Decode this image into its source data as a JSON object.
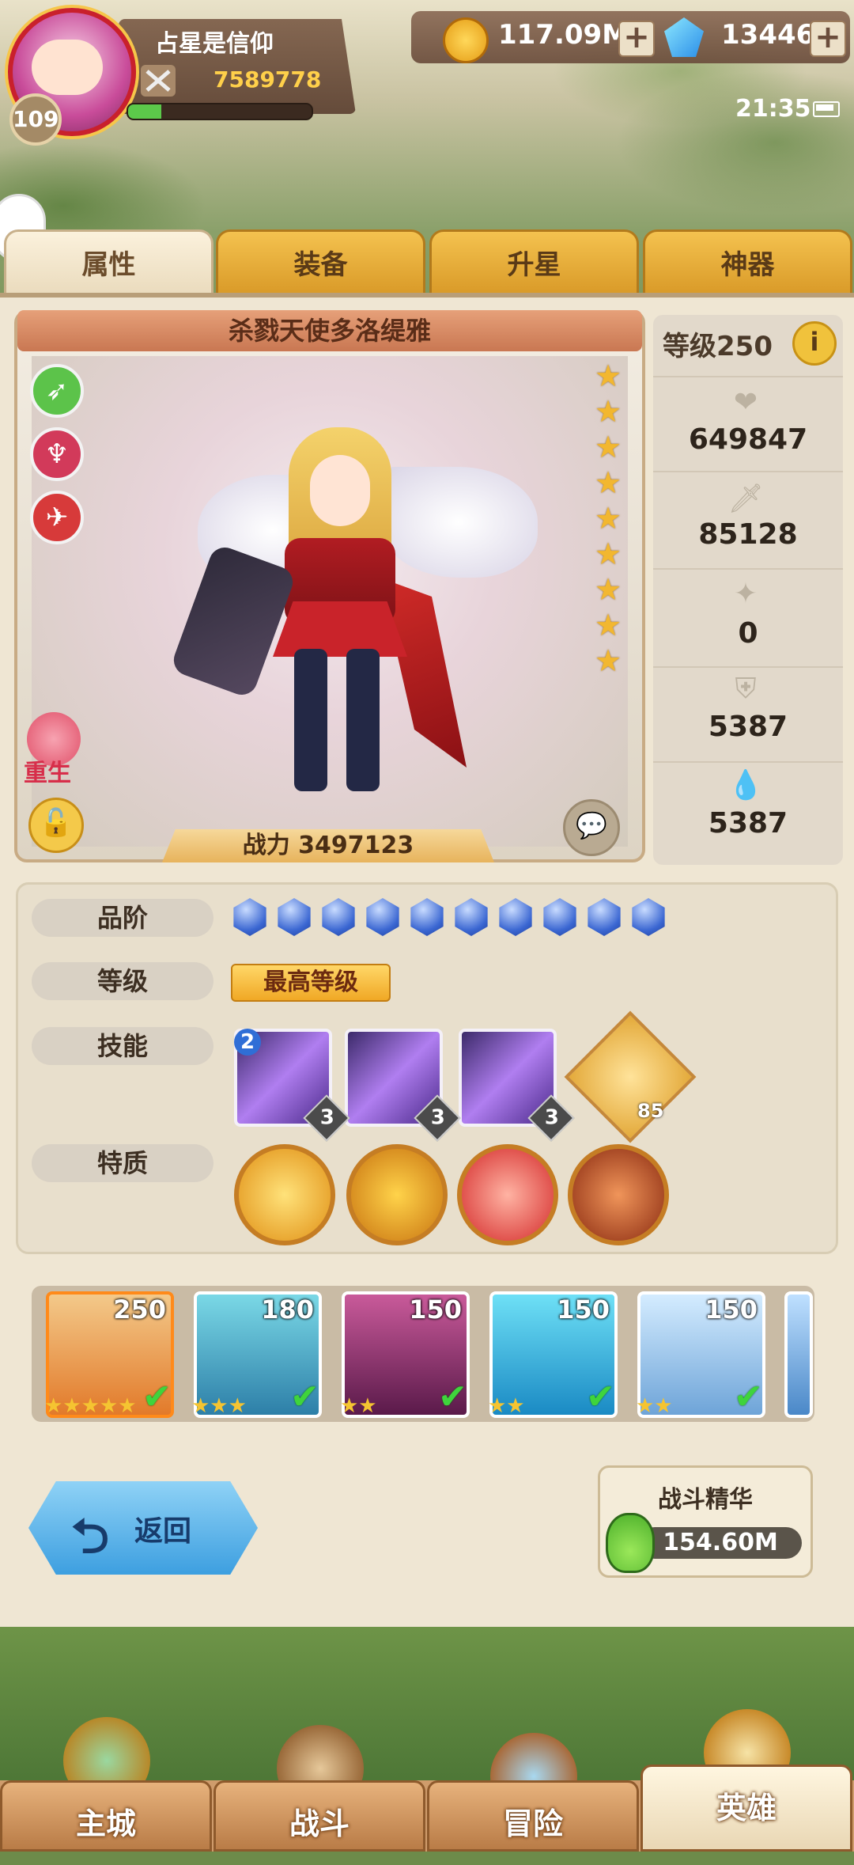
{
  "player": {
    "name": "占星是信仰",
    "level": "109",
    "power": "7589778"
  },
  "currency": {
    "gold": "117.09M",
    "gems": "13446",
    "add_label": "+"
  },
  "status": {
    "time": "21:35"
  },
  "tabs": [
    "属性",
    "装备",
    "升星",
    "神器"
  ],
  "hero": {
    "name": "杀戮天使多洛缇雅",
    "battle_power": "战力 3497123",
    "level_label": "等级250",
    "info_label": "i",
    "stars": 9,
    "rebirth_label": "重生",
    "stats": [
      "649847",
      "85128",
      "0",
      "5387",
      "5387"
    ],
    "stat_icons": [
      "heart-icon",
      "sword-icon",
      "star-icon",
      "shield-icon",
      "drop-icon"
    ]
  },
  "details": {
    "grade_label": "品阶",
    "grade_count": 10,
    "level_label": "等级",
    "level_value": "最高等级",
    "skill_label": "技能",
    "skill_badge": "2",
    "skills": [
      {
        "level": "3"
      },
      {
        "level": "3"
      },
      {
        "level": "3"
      }
    ],
    "passive_level": "85",
    "trait_label": "特质",
    "trait_count": 4
  },
  "roster": [
    {
      "level": "250",
      "stars": "★★★★★"
    },
    {
      "level": "180",
      "stars": "★★★"
    },
    {
      "level": "150",
      "stars": "★★"
    },
    {
      "level": "150",
      "stars": "★★"
    },
    {
      "level": "150",
      "stars": "★★"
    }
  ],
  "actions": {
    "back_label": "返回",
    "essence_title": "战斗精华",
    "essence_value": "154.60M"
  },
  "nav": [
    "主城",
    "战斗",
    "冒险",
    "英雄"
  ],
  "colors": {
    "accent": "#f0a825",
    "gem_blue": "#3b67d2"
  }
}
